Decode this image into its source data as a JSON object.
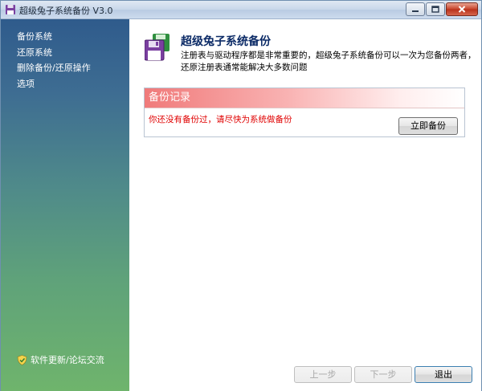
{
  "window": {
    "title": "超级兔子系统备份 V3.0",
    "minimize_icon": "minimize-icon",
    "maximize_icon": "maximize-icon",
    "close_icon": "close-icon"
  },
  "sidebar": {
    "items": [
      {
        "label": "备份系统"
      },
      {
        "label": "还原系统"
      },
      {
        "label": "删除备份/还原操作"
      },
      {
        "label": "选项"
      }
    ],
    "update_link": "软件更新/论坛交流"
  },
  "header": {
    "title": "超级兔子系统备份",
    "description": "注册表与驱动程序都是非常重要的，超级兔子系统备份可以一次为您备份两者，还原注册表通常能解决大多数问题"
  },
  "backup_panel": {
    "title": "备份记录",
    "message": "你还没有备份过，请尽快为系统做备份",
    "button": "立即备份"
  },
  "footer": {
    "prev": "上一步",
    "next": "下一步",
    "exit": "退出"
  },
  "colors": {
    "message_red": "#e00000",
    "title_blue": "#0b2a66",
    "panel_header_red": "#f07a7a"
  }
}
